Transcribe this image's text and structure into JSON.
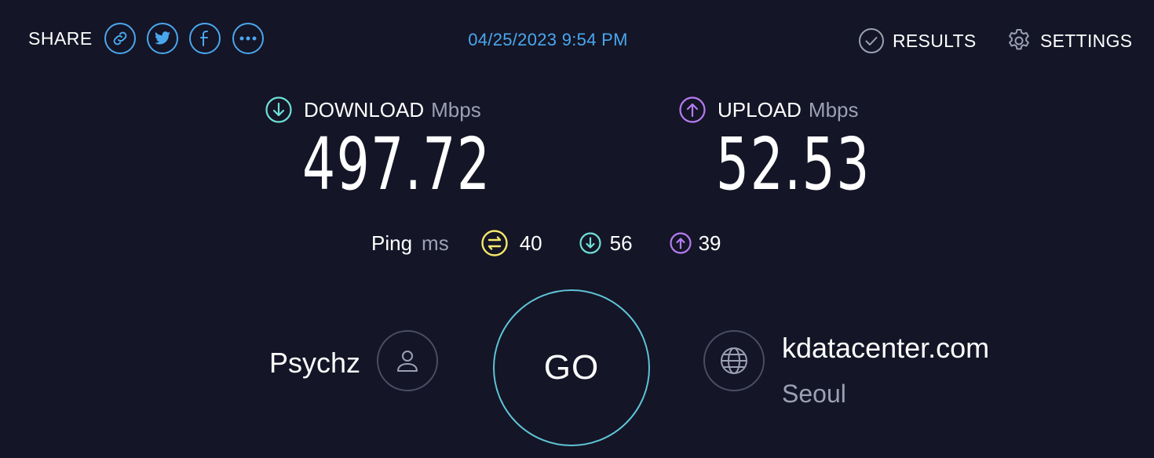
{
  "share": {
    "label": "SHARE",
    "icons": [
      "link-icon",
      "twitter-icon",
      "facebook-icon",
      "more-icon"
    ]
  },
  "timestamp": "04/25/2023 9:54 PM",
  "nav": {
    "results_label": "RESULTS",
    "settings_label": "SETTINGS"
  },
  "download": {
    "label": "DOWNLOAD",
    "unit": "Mbps",
    "value": "497.72",
    "color": "#6fe0d8"
  },
  "upload": {
    "label": "UPLOAD",
    "unit": "Mbps",
    "value": "52.53",
    "color": "#b67cf2"
  },
  "ping": {
    "label": "Ping",
    "unit": "ms",
    "idle": "40",
    "download": "56",
    "upload": "39",
    "idle_color": "#f5e96a"
  },
  "go_label": "GO",
  "provider": {
    "name": "Psychz"
  },
  "server": {
    "host": "kdatacenter.com",
    "location": "Seoul"
  },
  "colors": {
    "background": "#141526",
    "accent": "#4aa7ee",
    "go_ring": "#5fc3d6",
    "muted": "#9ba0b3"
  }
}
